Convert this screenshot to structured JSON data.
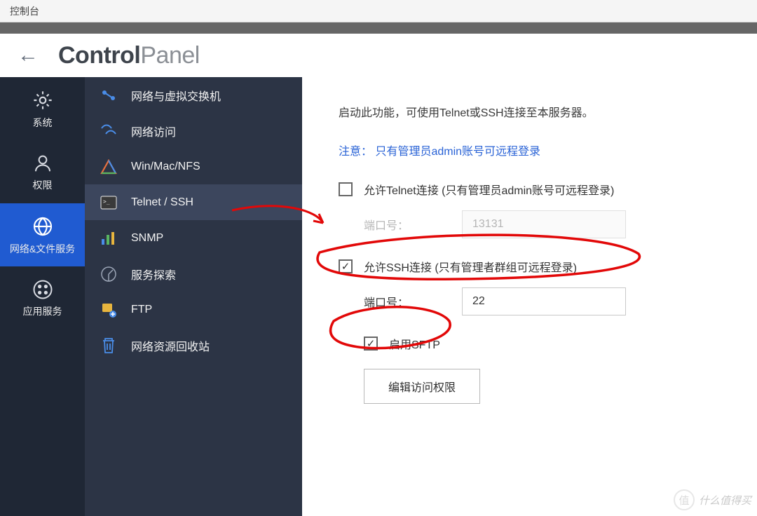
{
  "window": {
    "title": "控制台"
  },
  "header": {
    "bold": "Control",
    "thin": "Panel"
  },
  "sidebar1": {
    "items": [
      {
        "label": "系统"
      },
      {
        "label": "权限"
      },
      {
        "label": "网络&文件服务"
      },
      {
        "label": "应用服务"
      }
    ]
  },
  "sidebar2": {
    "items": [
      {
        "label": "网络与虚拟交换机"
      },
      {
        "label": "网络访问"
      },
      {
        "label": "Win/Mac/NFS"
      },
      {
        "label": "Telnet / SSH"
      },
      {
        "label": "SNMP"
      },
      {
        "label": "服务探索"
      },
      {
        "label": "FTP"
      },
      {
        "label": "网络资源回收站"
      }
    ]
  },
  "content": {
    "intro": "启动此功能，可使用Telnet或SSH连接至本服务器。",
    "notice": "注意： 只有管理员admin账号可远程登录",
    "telnet": {
      "label": "允许Telnet连接 (只有管理员admin账号可远程登录)",
      "port_label": "端口号：",
      "port_value": "13131"
    },
    "ssh": {
      "label": "允许SSH连接 (只有管理者群组可远程登录)",
      "port_label": "端口号：",
      "port_value": "22"
    },
    "sftp": {
      "label": "启用SFTP"
    },
    "edit_button": "编辑访问权限"
  },
  "watermark": {
    "badge": "值",
    "text": "什么值得买"
  }
}
